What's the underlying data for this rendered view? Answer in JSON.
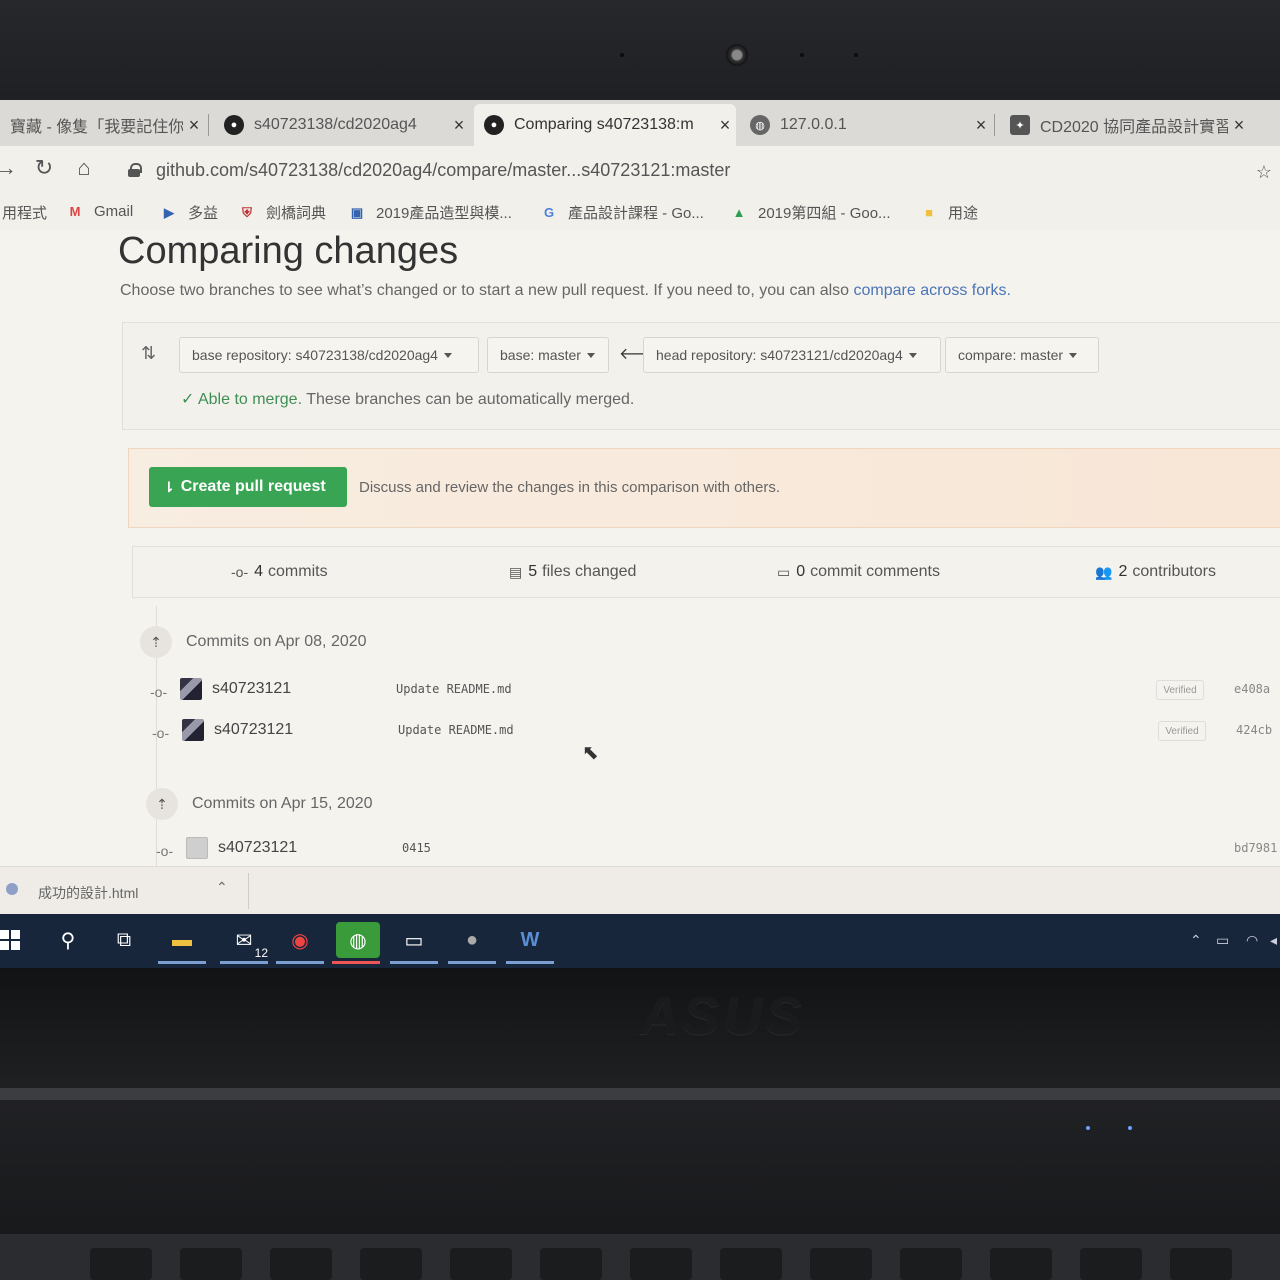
{
  "tabs": [
    {
      "title": "寶藏 - 像隻「我要記住你",
      "close": "×"
    },
    {
      "title": "s40723138/cd2020ag4",
      "close": "×"
    },
    {
      "title": "Comparing s40723138:m",
      "close": "×"
    },
    {
      "title": "127.0.0.1",
      "close": "×"
    },
    {
      "title": "CD2020 協同產品設計實習",
      "close": "×"
    }
  ],
  "address": {
    "url": "github.com/s40723138/cd2020ag4/compare/master...s40723121:master"
  },
  "bookmarks": [
    "用程式",
    "Gmail",
    "多益",
    "劍橋詞典",
    "2019產品造型與模...",
    "產品設計課程 - Go...",
    "2019第四組 - Goo...",
    "用途"
  ],
  "page": {
    "title": "Comparing changes",
    "subtitle": "Choose two branches to see what’s changed or to start a new pull request. If you need to, you can also",
    "subtitle_link": "compare across forks.",
    "base_repo": "base repository: s40723138/cd2020ag4",
    "base_branch": "base: master",
    "head_repo": "head repository: s40723121/cd2020ag4",
    "compare_branch": "compare: master",
    "merge_ok": "Able to merge.",
    "merge_text": "These branches can be automatically merged.",
    "create_pr": "Create pull request",
    "pr_hint": "Discuss and review the changes in this comparison with others."
  },
  "stats": {
    "commits_n": "4",
    "commits_label": "commits",
    "files_n": "5",
    "files_label": "files changed",
    "comments_n": "0",
    "comments_label": "commit comments",
    "contributors_n": "2",
    "contributors_label": "contributors"
  },
  "commit_groups": [
    {
      "heading": "Commits on Apr 08, 2020",
      "commits": [
        {
          "author": "s40723121",
          "message": "Update README.md",
          "verified": "Verified",
          "sha": "e408a"
        },
        {
          "author": "s40723121",
          "message": "Update README.md",
          "verified": "Verified",
          "sha": "424cb"
        }
      ]
    },
    {
      "heading": "Commits on Apr 15, 2020",
      "commits": [
        {
          "author": "s40723121",
          "message": "0415",
          "sha": "bd7981"
        }
      ]
    }
  ],
  "download": {
    "filename": "成功的設計.html"
  },
  "taskbar": {
    "mail_badge": "12"
  },
  "hardware": {
    "brand": "ASUS"
  }
}
